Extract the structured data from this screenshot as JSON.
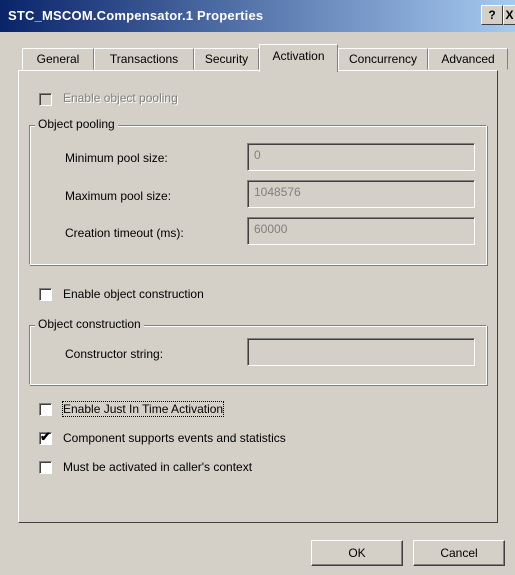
{
  "window": {
    "title": "STC_MSCOM.Compensator.1 Properties",
    "help_label": "?",
    "close_label": "X"
  },
  "tabs": [
    {
      "label": "General"
    },
    {
      "label": "Transactions"
    },
    {
      "label": "Security"
    },
    {
      "label": "Activation",
      "active": true
    },
    {
      "label": "Concurrency"
    },
    {
      "label": "Advanced"
    }
  ],
  "activation": {
    "enable_pooling": {
      "label": "Enable object pooling",
      "checked": false,
      "disabled": true
    },
    "pooling_group": {
      "legend": "Object pooling",
      "min_label": "Minimum pool size:",
      "min_value": "0",
      "max_label": "Maximum pool size:",
      "max_value": "1048576",
      "timeout_label": "Creation timeout (ms):",
      "timeout_value": "60000"
    },
    "enable_construction": {
      "label": "Enable object construction",
      "checked": false
    },
    "construction_group": {
      "legend": "Object construction",
      "ctor_label": "Constructor string:",
      "ctor_value": ""
    },
    "jit": {
      "label": "Enable Just In Time Activation",
      "checked": false
    },
    "events": {
      "label": "Component supports events and statistics",
      "checked": true
    },
    "caller_ctx": {
      "label": "Must be activated in caller's context",
      "checked": false
    }
  },
  "buttons": {
    "ok": "OK",
    "cancel": "Cancel"
  }
}
